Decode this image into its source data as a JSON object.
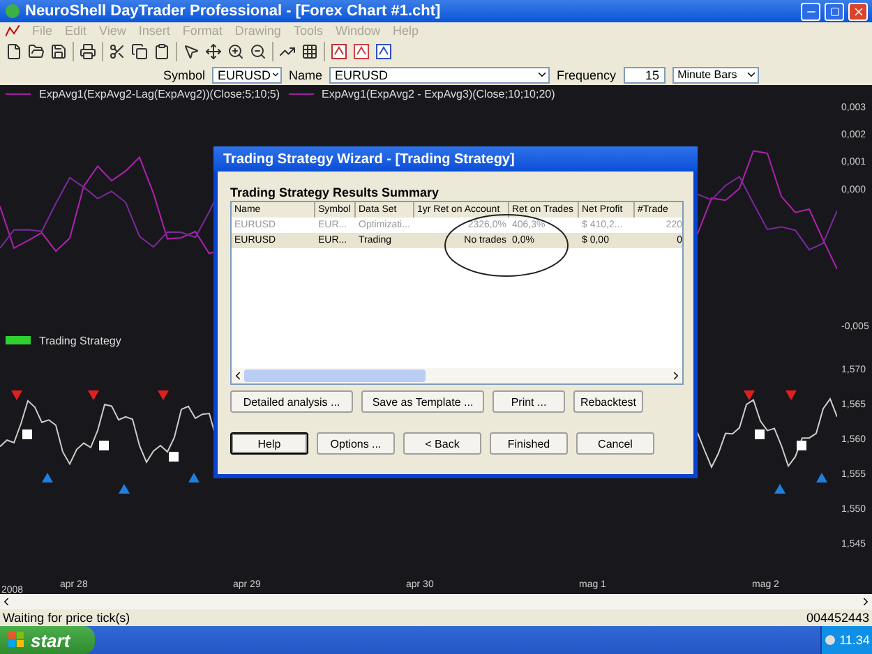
{
  "window": {
    "title": "NeuroShell DayTrader Professional - [Forex Chart #1.cht]"
  },
  "menu": [
    {
      "label": "File",
      "disabled": true
    },
    {
      "label": "Edit",
      "disabled": true
    },
    {
      "label": "View",
      "disabled": true
    },
    {
      "label": "Insert",
      "disabled": true
    },
    {
      "label": "Format",
      "disabled": true
    },
    {
      "label": "Drawing",
      "disabled": true
    },
    {
      "label": "Tools",
      "disabled": true
    },
    {
      "label": "Window",
      "disabled": true
    },
    {
      "label": "Help",
      "disabled": true
    }
  ],
  "symbol_bar": {
    "symbol_label": "Symbol",
    "symbol": "EURUSD",
    "name_label": "Name",
    "name": "EURUSD",
    "frequency_label": "Frequency",
    "frequency": "15",
    "bars": "Minute Bars"
  },
  "top_pane": {
    "legend": [
      "ExpAvg1(ExpAvg2-Lag(ExpAvg2))(Close;5;10;5)",
      "ExpAvg1(ExpAvg2 - ExpAvg3)(Close;10;10;20)"
    ],
    "y_labels": [
      "0,003",
      "0,002",
      "0,001",
      "0,000",
      "-0,005"
    ]
  },
  "bottom_pane": {
    "legend": "Trading Strategy",
    "y_labels": [
      "1,570",
      "1,565",
      "1,560",
      "1,555",
      "1,550",
      "1,545"
    ]
  },
  "x_axis": {
    "year": "2008",
    "labels": [
      "apr 28",
      "apr 29",
      "apr 30",
      "mag 1",
      "mag 2"
    ]
  },
  "status_bar": {
    "message": "Waiting for price tick(s)",
    "counter": "004452443"
  },
  "taskbar": {
    "start": "start",
    "clock": "11.34"
  },
  "dialog": {
    "title": "Trading Strategy Wizard - [Trading Strategy]",
    "heading": "Trading Strategy Results Summary",
    "columns": [
      "Name",
      "Symbol",
      "Data Set",
      "1yr Ret on Account",
      "Ret on Trades",
      "Net Profit",
      "#Trade"
    ],
    "rows": [
      {
        "cells": [
          "EURUSD",
          "EUR...",
          "Optimizati...",
          "2326,0%",
          "406,3%",
          "$ 410,2...",
          "220"
        ],
        "dimmed": true,
        "selected": false
      },
      {
        "cells": [
          "EURUSD",
          "EUR...",
          "Trading",
          "No trades",
          "0,0%",
          "$ 0,00",
          "0"
        ],
        "dimmed": false,
        "selected": true
      }
    ],
    "actions": [
      "Detailed analysis ...",
      "Save as Template ...",
      "Print ...",
      "Rebacktest"
    ],
    "footer": [
      {
        "label": "Help",
        "selected": true
      },
      {
        "label": "Options ...",
        "selected": false
      },
      {
        "label": "< Back",
        "selected": false
      },
      {
        "label": "Finished",
        "selected": false
      },
      {
        "label": "Cancel",
        "selected": false
      }
    ]
  }
}
